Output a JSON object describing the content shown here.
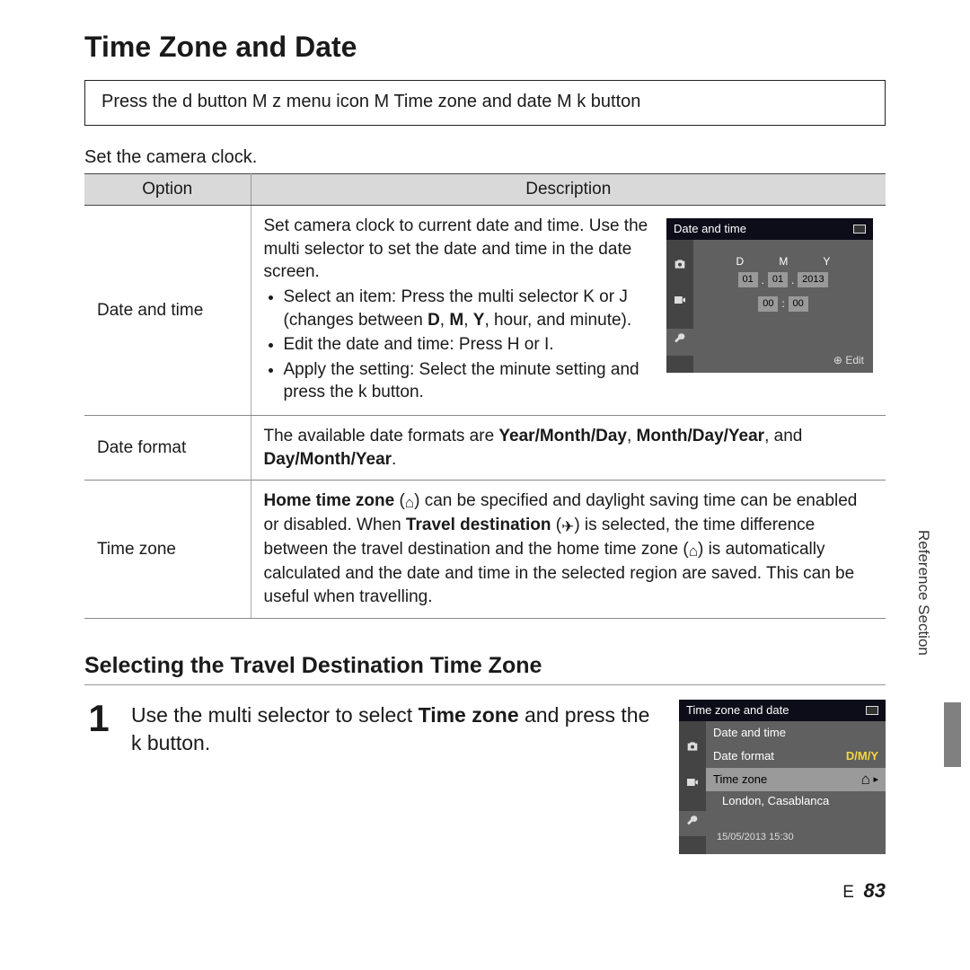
{
  "title": "Time Zone and Date",
  "nav": {
    "press_the": "Press the ",
    "d": "d",
    "button": " button ",
    "M1": "M",
    "z": " z ",
    "menu_icon": " menu icon ",
    "M2": "M",
    "tz_date": " Time zone and date ",
    "M3": "M",
    "k": " k ",
    "button2": " button"
  },
  "intro": "Set the camera clock.",
  "table": {
    "head_option": "Option",
    "head_description": "Description",
    "row1": {
      "option": "Date and time",
      "p1": "Set camera clock to current date and time. Use the multi selector to set the date and time in the date screen.",
      "b1a": "Select an item: Press the multi selector ",
      "b1b": " (changes between ",
      "b1c": ", hour, and minute).",
      "k_glyph": "K",
      "or": " or ",
      "j_glyph": "J",
      "D": "D",
      "M": "M",
      "Y": "Y",
      "b2a": "Edit the date and time: Press ",
      "H": "H",
      "I": "I",
      "dot": ".",
      "b3a": "Apply the setting: Select the minute setting and press the ",
      "k": "k",
      "b3b": " button."
    },
    "row2": {
      "option": "Date format",
      "p_a": "The available date formats are ",
      "f1": "Year/Month/Day",
      "f2": "Month/Day/Year",
      "and": ", and ",
      "f3": "Day/Month/Year",
      "comma": ", ",
      "end": "."
    },
    "row3": {
      "option": "Time zone",
      "home_tz": "Home time zone",
      "p1": " (",
      "p2": ") can be specified and daylight saving time can be enabled or disabled. When ",
      "travel_dest": "Travel destination",
      "p3": " (",
      "p4": ") is selected, the time difference between the travel destination and the home time zone (",
      "p5": ") is automatically calculated and the date and time in the selected region are saved. This can be useful when travelling."
    }
  },
  "screen1": {
    "title": "Date and time",
    "D": "D",
    "M": "M",
    "Y": "Y",
    "day": "01",
    "month": "01",
    "year": "2013",
    "hour": "00",
    "min": "00",
    "edit": "Edit"
  },
  "subtitle": "Selecting the Travel Destination Time Zone",
  "step1": {
    "num": "1",
    "text_a": "Use the multi selector to select ",
    "tz": "Time zone",
    "text_b": " and press the ",
    "k": "k",
    "text_c": " button."
  },
  "screen2": {
    "title": "Time zone and date",
    "item1": "Date and time",
    "item2": "Date format",
    "item2v": "D/M/Y",
    "item3": "Time zone",
    "city": "London, Casablanca",
    "footer": "15/05/2013  15:30"
  },
  "side_label": "Reference Section",
  "page_letter": "E",
  "page_number": "83"
}
